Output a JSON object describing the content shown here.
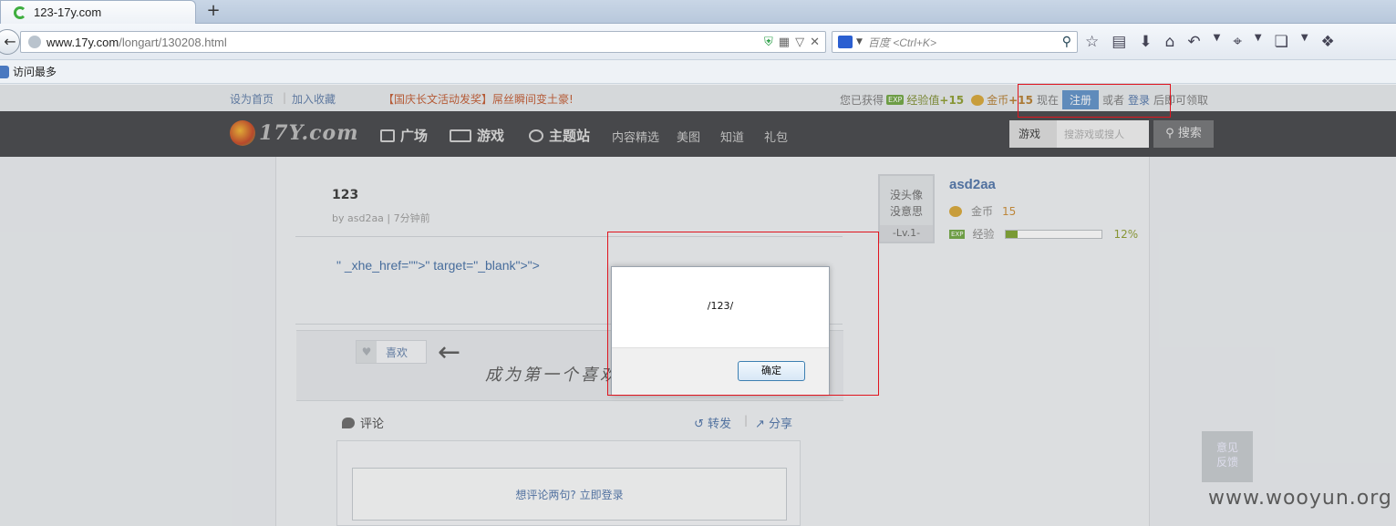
{
  "browser": {
    "tab_title": "123-17y.com",
    "new_tab": "+",
    "url_host": "www.17y.com",
    "url_path": "/longart/130208.html",
    "search_placeholder": "百度 <Ctrl+K>",
    "bookmark_label": "访问最多"
  },
  "site": {
    "top_links": [
      "设为首页",
      "加入收藏"
    ],
    "promo": "【国庆长文活动发奖】屌丝瞬间变土豪!",
    "reward": {
      "prefix": "您已获得",
      "exp_badge": "EXP",
      "exp_label": "经验值",
      "exp_value": "+15",
      "coin_label": "金币",
      "coin_value": "+15",
      "now": "现在",
      "register": "注册",
      "or": "或者",
      "login": "登录",
      "suffix": "后即可领取"
    },
    "logo_text": "17Y.com",
    "nav": [
      "广场",
      "游戏",
      "主题站",
      "内容精选",
      "美图",
      "知道",
      "礼包"
    ],
    "search_select": "游戏",
    "search_placeholder": "搜游戏或搜人",
    "search_button": "搜索"
  },
  "post": {
    "title": "123",
    "meta": "by asd2aa  |  7分钟前",
    "body": "\" _xhe_href=\"\">\" target=\"_blank\">\">",
    "like_label": "喜欢",
    "hand_text": "成为第一个喜欢",
    "comment_tab": "评论",
    "forward": "转发",
    "share": "分享",
    "comment_login": "想评论两句? 立即登录"
  },
  "user": {
    "avatar_text_1": "没头像",
    "avatar_text_2": "没意思",
    "level": "-Lv.1-",
    "name": "asd2aa",
    "coin_label": "金币",
    "coin_value": "15",
    "exp_label": "经验",
    "exp_pct_text": "12%",
    "exp_fraction": 0.12
  },
  "feedback": "意见\n反馈",
  "watermark": "www.wooyun.org",
  "dialog": {
    "message": "/123/",
    "ok": "确定"
  }
}
